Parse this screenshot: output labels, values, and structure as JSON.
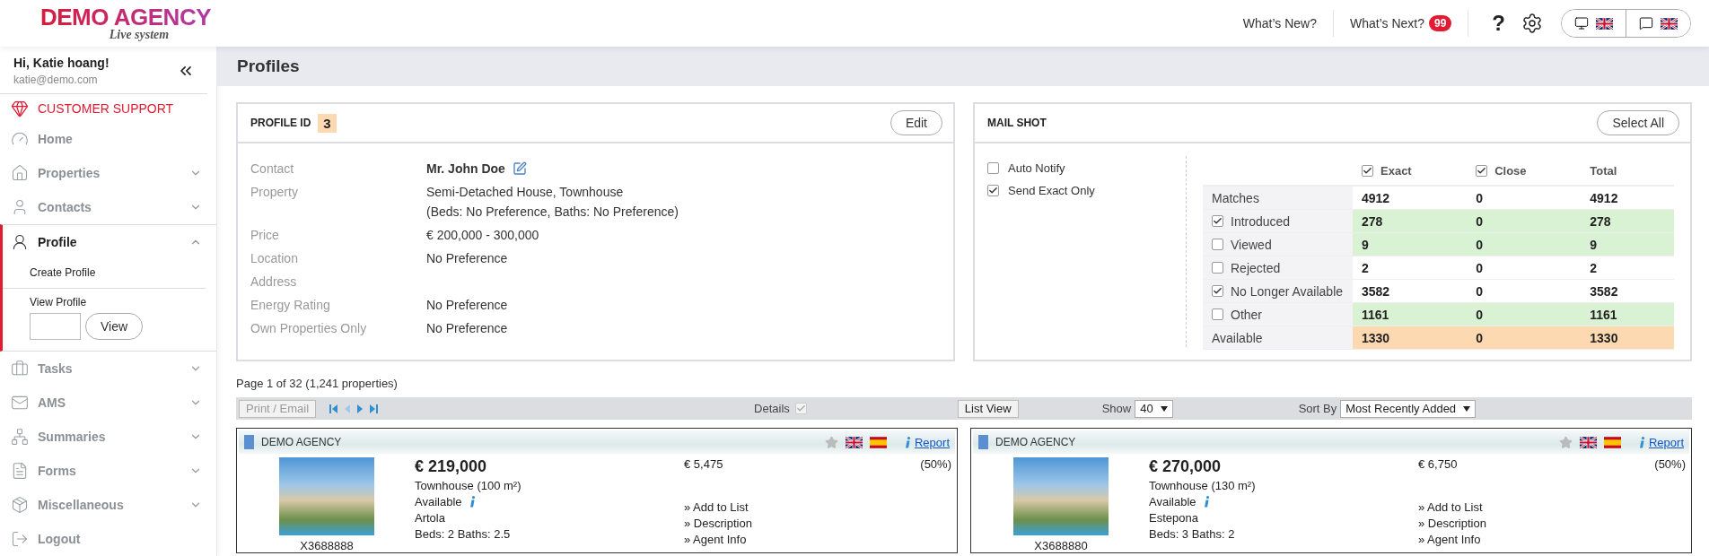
{
  "header": {
    "logo": {
      "name": "DEMO AGENCY",
      "tagline": "Live system"
    },
    "links": [
      {
        "label": "What’s New?"
      },
      {
        "label": "What’s Next?",
        "badge": "99"
      }
    ],
    "help": "?"
  },
  "sidebar": {
    "greeting": "Hi, Katie hoang!",
    "email": "katie@demo.com",
    "support": "CUSTOMER SUPPORT",
    "items": [
      {
        "kind": "link",
        "label": "Home",
        "selected": false
      },
      {
        "kind": "group",
        "label": "Properties",
        "selected": false,
        "expanded": false
      },
      {
        "kind": "group",
        "label": "Contacts",
        "selected": false,
        "expanded": false
      },
      {
        "kind": "group",
        "label": "Profile",
        "selected": true,
        "expanded": true,
        "children": [
          {
            "kind": "link",
            "label": "Create Profile"
          },
          {
            "kind": "lookup",
            "label": "View Profile",
            "button": "View"
          }
        ]
      },
      {
        "kind": "group",
        "label": "Tasks",
        "selected": false,
        "expanded": false
      },
      {
        "kind": "group",
        "label": "AMS",
        "selected": false,
        "expanded": false
      },
      {
        "kind": "group",
        "label": "Summaries",
        "selected": false,
        "expanded": false
      },
      {
        "kind": "group",
        "label": "Forms",
        "selected": false,
        "expanded": false
      },
      {
        "kind": "group",
        "label": "Miscellaneous",
        "selected": false,
        "expanded": false
      },
      {
        "kind": "link",
        "label": "Logout",
        "selected": false
      }
    ]
  },
  "page_title": "Profiles",
  "profile": {
    "title": "PROFILE ID",
    "id": "3",
    "edit": "Edit",
    "fields": [
      {
        "kind": "contact",
        "label": "Contact",
        "lines": [
          "Mr. John Doe"
        ]
      },
      {
        "kind": "text",
        "label": "Property",
        "lines": [
          "Semi-Detached House, Townhouse",
          "(Beds: No Preference, Baths: No Preference)"
        ]
      },
      {
        "kind": "text",
        "label": "Price",
        "lines": [
          "€ 200,000 - 300,000"
        ]
      },
      {
        "kind": "text",
        "label": "Location",
        "lines": [
          "No Preference"
        ]
      },
      {
        "label": "Address"
      },
      {
        "kind": "text",
        "label": "Energy Rating",
        "lines": [
          "No Preference"
        ]
      },
      {
        "kind": "text",
        "label": "Own Properties Only",
        "lines": [
          "No Preference"
        ]
      }
    ]
  },
  "mail_shot": {
    "title": "MAIL SHOT",
    "button": "Select All",
    "options": [
      {
        "label": "Auto Notify",
        "checked": false
      },
      {
        "label": "Send Exact Only",
        "checked": true
      }
    ],
    "table": {
      "columns": [
        {
          "label": "Exact",
          "checked": true
        },
        {
          "label": "Close",
          "checked": true
        },
        {
          "label": "Total"
        }
      ],
      "rows": [
        {
          "kind": "plain",
          "label": "Matches",
          "values": [
            "4912",
            "0",
            "4912"
          ]
        },
        {
          "kind": "check",
          "label": "Introduced",
          "checked": true,
          "values": [
            "278",
            "0",
            "278"
          ],
          "color": "#daf2d4"
        },
        {
          "kind": "check",
          "label": "Viewed",
          "checked": false,
          "values": [
            "9",
            "0",
            "9"
          ],
          "color": "#daf2d4"
        },
        {
          "kind": "check",
          "label": "Rejected",
          "checked": false,
          "values": [
            "2",
            "0",
            "2"
          ]
        },
        {
          "kind": "check",
          "label": "No Longer Available",
          "checked": true,
          "values": [
            "3582",
            "0",
            "3582"
          ]
        },
        {
          "kind": "check",
          "label": "Other",
          "checked": false,
          "values": [
            "1161",
            "0",
            "1161"
          ],
          "color": "#daf2d4"
        },
        {
          "kind": "plain",
          "label": "Available",
          "values": [
            "1330",
            "0",
            "1330"
          ],
          "color": "#fdd9b1"
        }
      ]
    }
  },
  "results": {
    "summary": "Page 1 of 32 (1,241 properties)",
    "print": "Print / Email",
    "details": {
      "label": "Details",
      "checked": true,
      "disabled": true
    },
    "view_button": "List View",
    "show": {
      "label": "Show",
      "value": "40"
    },
    "sort": {
      "label": "Sort By",
      "value": "Most Recently Added"
    },
    "listings": [
      {
        "agency": "DEMO AGENCY",
        "favorite": false,
        "report": "Report",
        "price": "€ 219,000",
        "type": "Townhouse (100 m²)",
        "status": "Available",
        "location": "Artola",
        "rooms": "Beds: 2 Baths: 2.5",
        "ref": "X3688888",
        "commission": "€ 5,475",
        "share": "(50%)",
        "links": [
          "» Add to List",
          "» Description",
          "» Agent Info"
        ]
      },
      {
        "agency": "DEMO AGENCY",
        "favorite": false,
        "report": "Report",
        "price": "€ 270,000",
        "type": "Townhouse (130 m²)",
        "status": "Available",
        "location": "Estepona",
        "rooms": "Beds: 3 Baths: 2",
        "ref": "X3688880",
        "commission": "€ 6,750",
        "share": "(50%)",
        "links": [
          "» Add to List",
          "» Description",
          "» Agent Info"
        ]
      }
    ]
  }
}
